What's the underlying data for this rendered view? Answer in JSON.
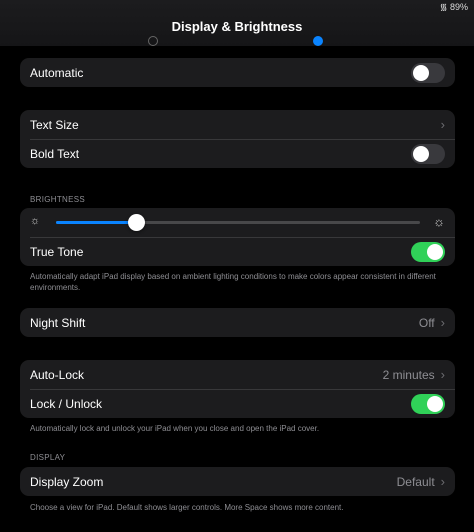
{
  "status": {
    "battery": "89%"
  },
  "header": {
    "title": "Display & Brightness"
  },
  "appearance": {
    "automatic_label": "Automatic",
    "automatic_on": false
  },
  "text": {
    "text_size_label": "Text Size",
    "bold_text_label": "Bold Text",
    "bold_text_on": false
  },
  "brightness": {
    "section_header": "BRIGHTNESS",
    "level": 0.22,
    "true_tone_label": "True Tone",
    "true_tone_on": true,
    "true_tone_note": "Automatically adapt iPad display based on ambient lighting conditions to make colors appear consistent in different environments."
  },
  "night_shift": {
    "label": "Night Shift",
    "value": "Off"
  },
  "lock": {
    "auto_lock_label": "Auto-Lock",
    "auto_lock_value": "2 minutes",
    "lock_unlock_label": "Lock / Unlock",
    "lock_unlock_on": true,
    "note": "Automatically lock and unlock your iPad when you close and open the iPad cover."
  },
  "display": {
    "section_header": "DISPLAY",
    "zoom_label": "Display Zoom",
    "zoom_value": "Default",
    "zoom_note": "Choose a view for iPad. Default shows larger controls. More Space shows more content."
  },
  "colors": {
    "accent": "#0a84ff",
    "toggle_on": "#30d158",
    "cell_bg": "#1c1c1e"
  }
}
